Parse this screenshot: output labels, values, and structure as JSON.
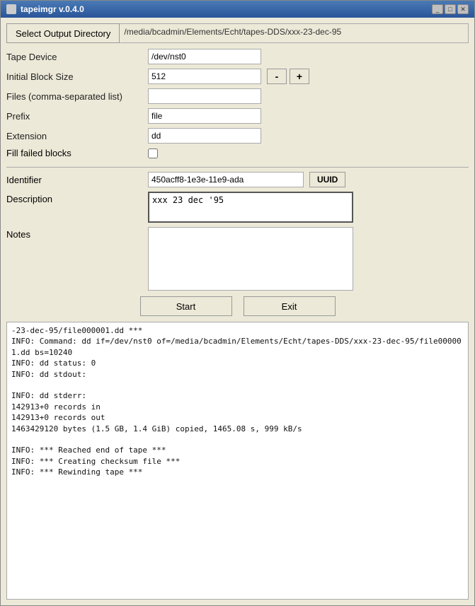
{
  "window": {
    "title": "tapeimgr v.0.4.0",
    "minimize_label": "_",
    "maximize_label": "□",
    "close_label": "✕"
  },
  "dir_button": {
    "label": "Select Output Directory"
  },
  "dir_path": {
    "value": "/media/bcadmin/Elements/Echt/tapes-DDS/xxx-23-dec-95"
  },
  "form": {
    "tape_device_label": "Tape Device",
    "tape_device_value": "/dev/nst0",
    "initial_block_size_label": "Initial Block Size",
    "initial_block_size_value": "512",
    "minus_label": "-",
    "plus_label": "+",
    "files_label": "Files (comma-separated list)",
    "files_value": "",
    "prefix_label": "Prefix",
    "prefix_value": "file",
    "extension_label": "Extension",
    "extension_value": "dd",
    "fill_failed_label": "Fill failed blocks",
    "identifier_label": "Identifier",
    "identifier_value": "450acff8-1e3e-11e9-ada",
    "uuid_label": "UUID",
    "description_label": "Description",
    "description_value": "xxx 23 dec '95",
    "notes_label": "Notes",
    "notes_value": "",
    "start_label": "Start",
    "exit_label": "Exit"
  },
  "log": {
    "text": "-23-dec-95/file000001.dd ***\nINFO: Command: dd if=/dev/nst0 of=/media/bcadmin/Elements/Echt/tapes-DDS/xxx-23-dec-95/file000001.dd bs=10240\nINFO: dd status: 0\nINFO: dd stdout:\n\nINFO: dd stderr:\n142913+0 records in\n142913+0 records out\n1463429120 bytes (1.5 GB, 1.4 GiB) copied, 1465.08 s, 999 kB/s\n\nINFO: *** Reached end of tape ***\nINFO: *** Creating checksum file ***\nINFO: *** Rewinding tape ***"
  }
}
